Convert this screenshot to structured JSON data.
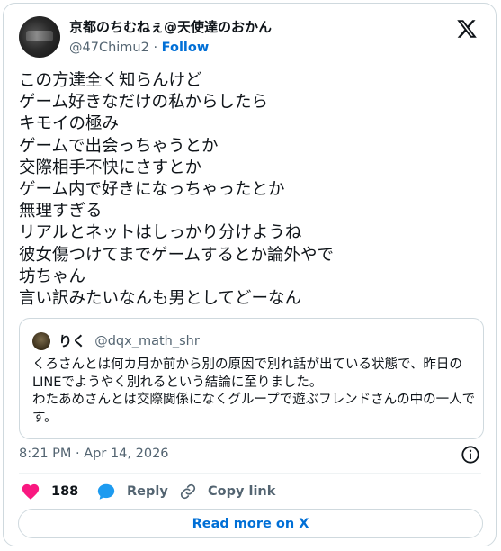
{
  "tweet": {
    "author": {
      "display_name": "京都のちむねぇ@天使達のおかん",
      "handle": "@47Chimu2",
      "follow_label": "Follow"
    },
    "text": "この方達全く知らんけど\nゲーム好きなだけの私からしたら\nキモイの極み\nゲームで出会っちゃうとか\n交際相手不快にさすとか\nゲーム内で好きになっちゃったとか\n無理すぎる\nリアルとネットはしっかり分けようね\n彼女傷つけてまでゲームするとか論外やで\n坊ちゃん\n言い訳みたいなんも男としてどーなん",
    "quoted": {
      "name": "りく",
      "handle": "@dqx_math_shr",
      "text": "くろさんとは何カ月か前から別の原因で別れ話が出ている状態で、昨日のLINEでようやく別れるという結論に至りました。\nわたあめさんとは交際関係になくグループで遊ぶフレンドさんの中の一人です。"
    },
    "timestamp": "8:21 PM · Apr 14, 2026",
    "actions": {
      "like_count": "188",
      "reply_label": "Reply",
      "copy_label": "Copy link"
    },
    "read_more_label": "Read more on X"
  },
  "colors": {
    "accent": "#006fd6",
    "like": "#f91880",
    "reply": "#1d9bf0",
    "muted": "#536471",
    "border": "#cfd9de"
  },
  "icons": [
    "x-logo-icon",
    "info-icon",
    "heart-icon",
    "reply-bubble-icon",
    "link-icon"
  ]
}
